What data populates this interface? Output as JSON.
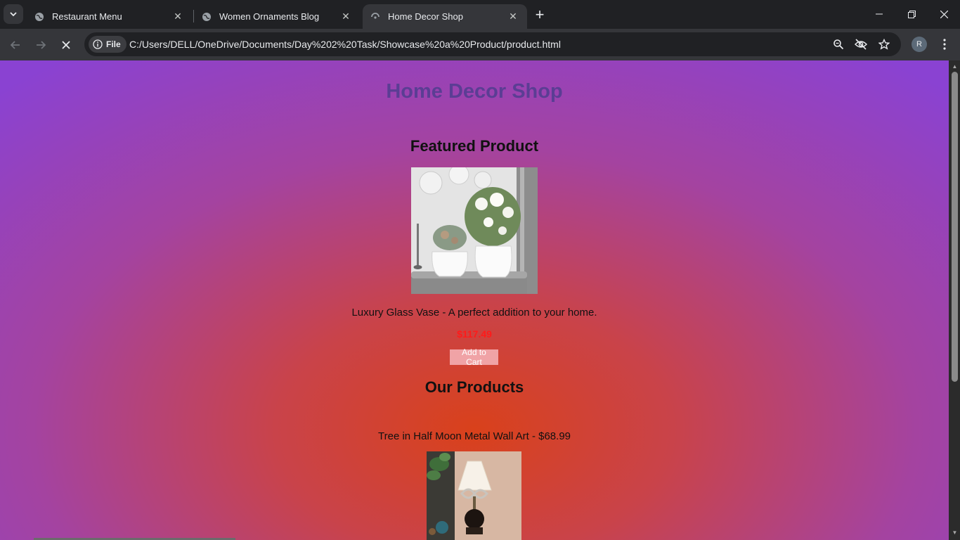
{
  "browser": {
    "tabs": [
      {
        "title": "Restaurant Menu",
        "active": false
      },
      {
        "title": "Women Ornaments Blog",
        "active": false
      },
      {
        "title": "Home Decor Shop",
        "active": true
      }
    ],
    "chip_label": "File",
    "url": "C:/Users/DELL/OneDrive/Documents/Day%202%20Task/Showcase%20a%20Product/product.html",
    "avatar_letter": "R"
  },
  "page": {
    "site_title": "Home Decor Shop",
    "featured": {
      "heading": "Featured Product",
      "image_alt": "Luxury Glass Vase",
      "description": "Luxury Glass Vase - A perfect addition to your home.",
      "price": "$117.49",
      "button_label": "Add to Cart"
    },
    "products": {
      "heading": "Our Products",
      "items": [
        {
          "label": "Tree in Half Moon Metal Wall Art - $68.99"
        }
      ]
    }
  },
  "colors": {
    "title": "#5b3d94",
    "price": "#ff1a1a",
    "button_bg": "#f0a3a6",
    "gradient_center": "#d9411b",
    "gradient_edge": "#8a42d2"
  }
}
